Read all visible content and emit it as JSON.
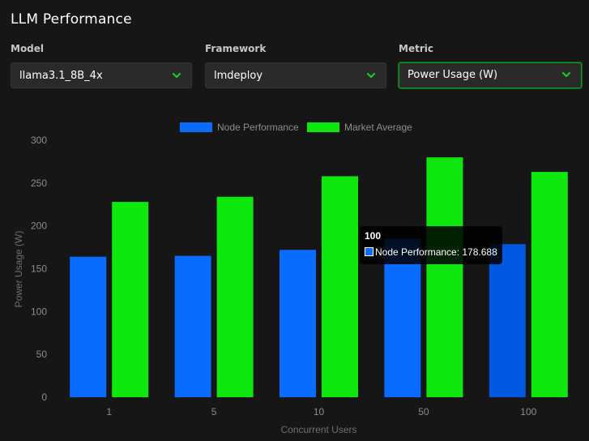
{
  "page": {
    "title": "LLM Performance"
  },
  "filters": {
    "model": {
      "label": "Model",
      "value": "llama3.1_8B_4x"
    },
    "framework": {
      "label": "Framework",
      "value": "lmdeploy"
    },
    "metric": {
      "label": "Metric",
      "value": "Power Usage (W)"
    }
  },
  "colors": {
    "node": "#0a6cff",
    "node_highlight": "#0058e0",
    "market": "#0ee80e",
    "accent": "#18c92b",
    "background": "#161616"
  },
  "icons": {
    "dropdown": "chevron-down-icon"
  },
  "tooltip": {
    "title": "100",
    "text": "Node Performance: 178.688"
  },
  "chart_data": {
    "type": "bar",
    "categories": [
      "1",
      "5",
      "10",
      "50",
      "100"
    ],
    "series": [
      {
        "name": "Node Performance",
        "values": [
          164,
          165,
          172,
          185,
          178.688
        ]
      },
      {
        "name": "Market Average",
        "values": [
          228,
          234,
          258,
          280,
          263
        ]
      }
    ],
    "xlabel": "Concurrent Users",
    "ylabel": "Power Usage (W)",
    "ylim": [
      0,
      300
    ],
    "yticks": [
      0,
      50,
      100,
      150,
      200,
      250,
      300
    ],
    "grid": false,
    "legend": "top-center",
    "highlighted_category": "100"
  }
}
